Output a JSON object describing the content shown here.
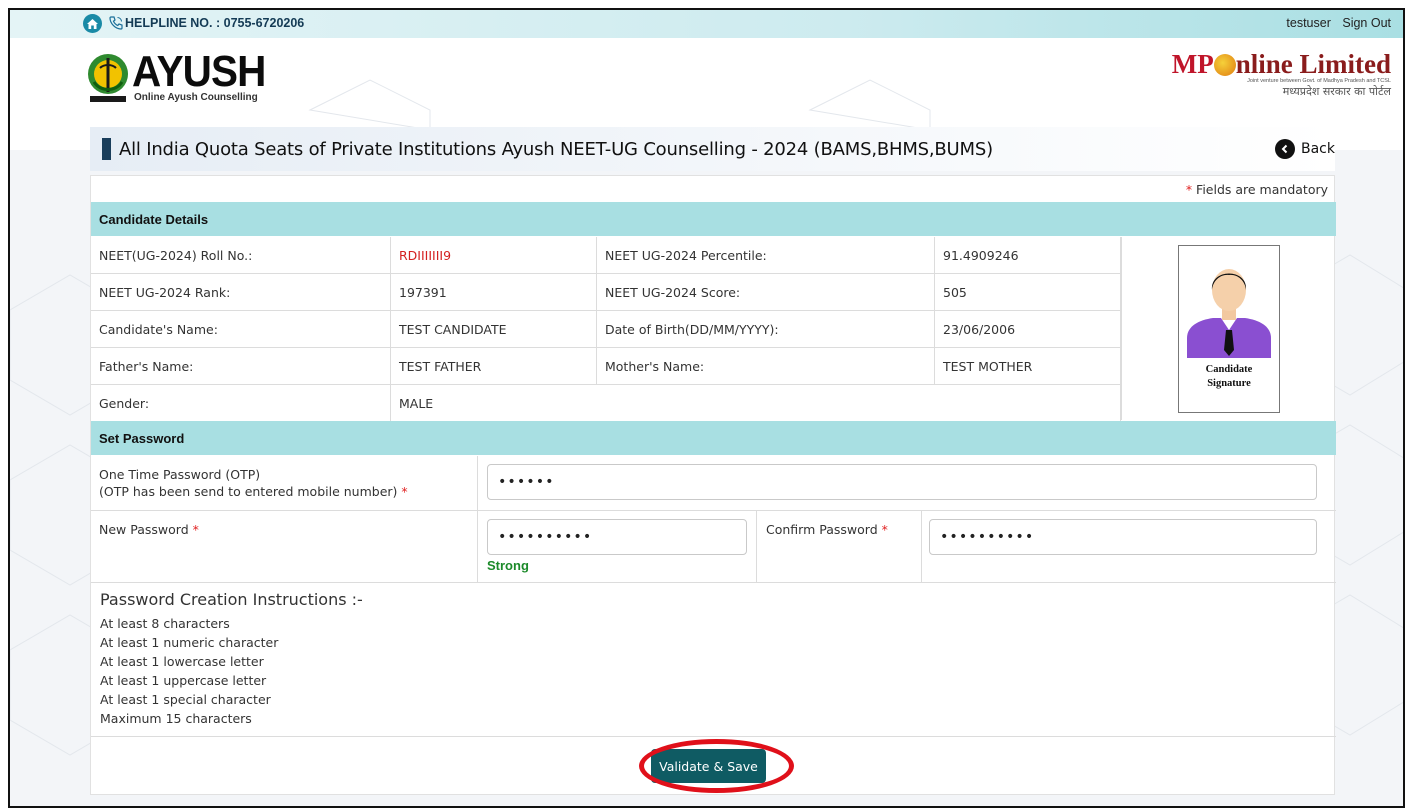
{
  "topbar": {
    "helpline": "HELPLINE NO. : 0755-6720206",
    "username": "testuser",
    "sign_out": "Sign Out"
  },
  "header": {
    "ayush_word": "AYUSH",
    "ayush_sub": "Online Ayush Counselling",
    "mp_prefix": "MP",
    "mp_suffix": "nline Limited",
    "mp_tag": "Joint venture between Govt. of Madhya Pradesh and TCSL",
    "mp_hindi": "मध्यप्रदेश सरकार का पोर्टल"
  },
  "title": {
    "text": "All India Quota Seats of Private Institutions Ayush NEET-UG Counselling - 2024 (BAMS,BHMS,BUMS)",
    "back_label": "Back"
  },
  "form": {
    "mandatory_star": "*",
    "mandatory_note": " Fields are mandatory",
    "candidate_header": "Candidate Details",
    "rows": [
      {
        "l1": "NEET(UG-2024) Roll No.:",
        "v1": "RDIIIIIII9",
        "l2": "NEET UG-2024 Percentile:",
        "v2": "91.4909246"
      },
      {
        "l1": "NEET UG-2024 Rank:",
        "v1": "197391",
        "l2": "NEET UG-2024 Score:",
        "v2": "505"
      },
      {
        "l1": "Candidate's Name:",
        "v1": "TEST CANDIDATE",
        "l2": "Date of Birth(DD/MM/YYYY):",
        "v2": "23/06/2006"
      },
      {
        "l1": "Father's Name:",
        "v1": "TEST FATHER",
        "l2": "Mother's Name:",
        "v2": "TEST MOTHER"
      },
      {
        "l1": "Gender:",
        "v1": "MALE"
      }
    ],
    "signature_label_1": "Candidate",
    "signature_label_2": "Signature",
    "password_header": "Set Password",
    "otp_label_1": "One Time Password (OTP)",
    "otp_label_2": "(OTP has been send to entered mobile number)",
    "otp_value": "••••••",
    "new_password_label": "New Password",
    "new_password_value": "••••••••••",
    "strength": "Strong",
    "confirm_password_label": "Confirm Password",
    "confirm_password_value": "••••••••••",
    "instructions_title": "Password Creation Instructions :-",
    "instructions": [
      "At least 8 characters",
      "At least 1 numeric character",
      "At least 1 lowercase letter",
      "At least 1 uppercase letter",
      "At least 1 special character",
      "Maximum 15 characters"
    ],
    "save_label": "Validate & Save"
  },
  "colors": {
    "section_header": "#a8dfe2",
    "button": "#0f5b63",
    "highlight": "#e0101a",
    "strength": "#1c8a2a"
  }
}
